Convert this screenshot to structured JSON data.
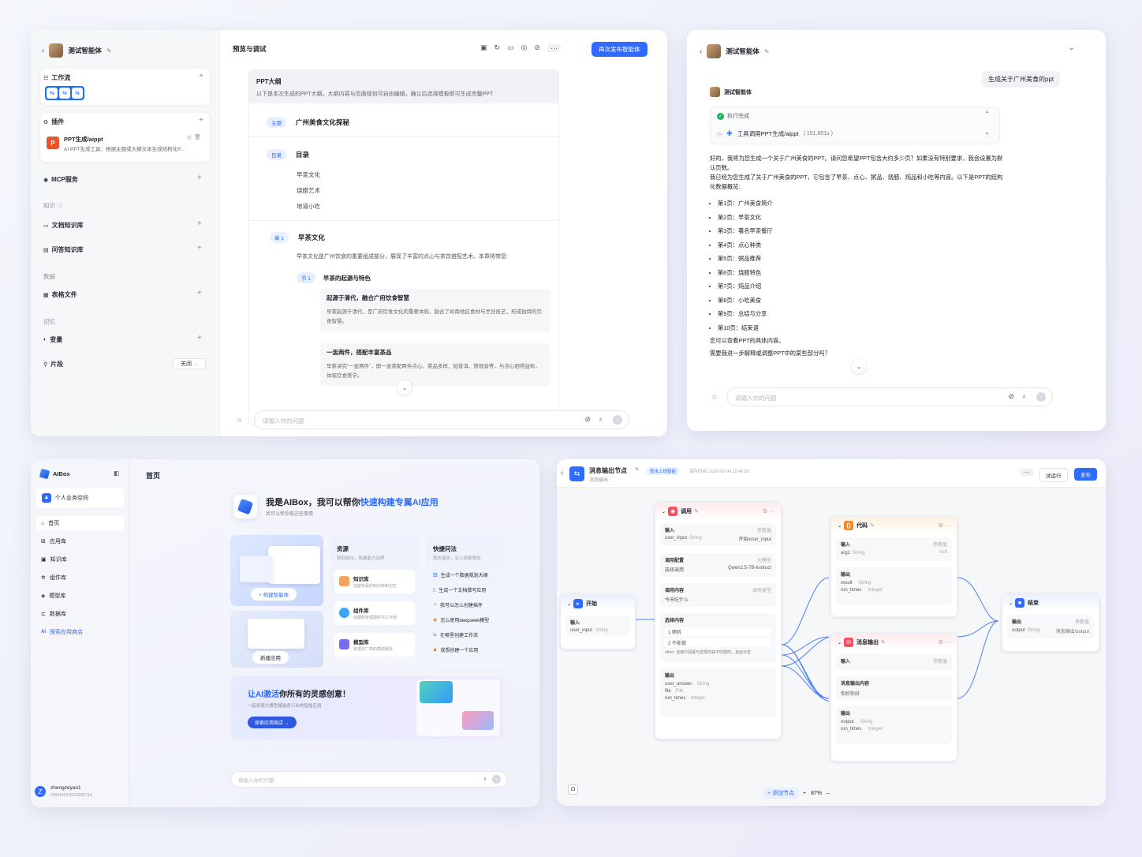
{
  "w1": {
    "agent_name": "测试智能体",
    "workflow_label": "工作流",
    "plugin_label": "插件",
    "plugin_name": "PPT生成/aippt",
    "plugin_desc": "AI PPT生成工具：根据主题或大纲文本生成结构化P...",
    "mcp_label": "MCP服务",
    "knowledge_label": "知识",
    "doc_kb": "文档知识库",
    "qa_kb": "问答知识库",
    "data_label": "数据",
    "table_file": "表格文件",
    "memory_label": "记忆",
    "variable": "变量",
    "snippet": "片段",
    "snippet_state": "关闭",
    "preview_title": "预览与调试",
    "publish_btn": "再次发布智能体",
    "outline_title": "PPT大纲",
    "outline_desc": "以下是本次生成的PPT大纲。大纲内容与页面规划可自由编辑，确认后选择模板即可生成完整PPT",
    "theme_tag": "主题",
    "theme": "广州美食文化探秘",
    "toc_tag": "目录",
    "toc_title": "目录",
    "toc_items": [
      "早茶文化",
      "烧腊艺术",
      "地道小吃"
    ],
    "ch_tag": "章 1",
    "ch_title": "早茶文化",
    "ch_desc": "早茶文化是广州饮食的重要组成部分，展现了丰富的点心与茶饮搭配艺术。本章将带您:",
    "sec_tag": "节 1",
    "sec_title": "早茶的起源与特色",
    "p1_title": "起源于清代，融合广府饮食智慧",
    "p1_text": "早茶起源于清代，是广府饮食文化的重要体现，融合了岭南地区食材与烹饪技艺，形成独特的饮食智慧。",
    "p2_title": "一盅两件，搭配丰富茶品",
    "p2_text": "早茶讲究“一盅两件”，即一盅茶配两件点心，茶品多样，如普洱、铁观音等，与点心相得益彰，体现饮食美学。",
    "input_ph": "请输入你的问题"
  },
  "w2": {
    "agent_name": "测试智能体",
    "user_msg": "生成关于广州美食的ppt",
    "bot_name": "测试智能体",
    "exec_done": "执行完成",
    "tool_call": "工具调用PPT生成/aippt",
    "tool_time": "( 151.851s )",
    "p1": "好的，我将为您生成一个关于广州美食的PPT。请问您希望PPT包含大约多少页？如果没有特别要求，我会设置为默认页数。",
    "p2": "我已经为您生成了关于广州美食的PPT，它包含了早茶、点心、粥品、烧腊、炖品和小吃等内容。以下是PPT的结构化数据概览:",
    "items": [
      "第1页：广州美食简介",
      "第2页：早茶文化",
      "第3页：著名早茶餐厅",
      "第4页：点心种类",
      "第5页：粥品推荐",
      "第6页：烧腊特色",
      "第7页：炖品介绍",
      "第8页：小吃美食",
      "第9页：总结与分享",
      "第10页：结束语"
    ],
    "p3": "您可以查看PPT的具体内容。",
    "p4": "需要我进一步解释或调整PPT中的某些部分吗？",
    "input_ph": "请输入你的问题"
  },
  "w3": {
    "brand": "AIBox",
    "workspace": "个人业务空间",
    "nav": [
      "首页",
      "应用库",
      "知识库",
      "组件库",
      "模型库",
      "数据库"
    ],
    "explore": "探索应用商店",
    "user_name": "zhengzeyan1",
    "user_id": "2004154378116595714",
    "page_title": "首页",
    "hero_pre": "我是AIBox，我可以帮你",
    "hero_hl": "快速构建专属AI应用",
    "hero_sub": "我可以帮你做这些事情",
    "build_btn": "+ 构建智能体",
    "new_app_btn": "新建应用",
    "res_title": "资源",
    "res_sub": "即刻前往，拓展能力边界",
    "res_items": [
      {
        "t": "知识库",
        "d": "创建专属的知识库和记忆"
      },
      {
        "t": "组件库",
        "d": "创建和管理插件与工作流"
      },
      {
        "t": "模型库",
        "d": "管理多厂商的模型服务"
      }
    ],
    "quick_title": "快捷问法",
    "quick_sub": "我也能答，深入探索体验",
    "quick_items": [
      "生成一个数据规划大纲",
      "生成一个文档撰写应用",
      "我可以怎么创建插件",
      "怎么使用deepseek模型",
      "在哪里创建工作流",
      "我想创建一个应用"
    ],
    "banner_pre": "让AI",
    "banner_hl": "激活",
    "banner_post": "你所有的灵感创意！",
    "banner_sub": "一起探索大模型赋能各行业的智能应用",
    "banner_btn": "探索应用商店 →",
    "input_ph": "请输入你的问题"
  },
  "w4": {
    "title": "消息输出节点",
    "subtitle": "消息输出",
    "badge": "暂未上线智能",
    "save_time": "保存时间: 2026-02-04 15:46:50",
    "trial_btn": "试运行",
    "publish_btn": "发布",
    "start": {
      "name": "开始",
      "in_label": "输入",
      "var": "user_input",
      "type": "String"
    },
    "llm": {
      "name": "调用",
      "in_label": "输入",
      "param": "参数值",
      "var": "user_input",
      "type": "String",
      "val": "开始/user_input",
      "cfg_label": "调用配置",
      "cfg_hint": "大模型",
      "model_label": "选择调用",
      "model": "Qwen2.5-7B-Instruct",
      "content_label": "调用内容",
      "content_hint": "调用类型",
      "content": "今天吃什么",
      "opt_label": "选择内容",
      "opts": [
        "1 随机",
        "2 不能做"
      ],
      "other": "other: 当用户回答与选项内容不匹配时，走此分支",
      "out_label": "输出",
      "outs": [
        {
          "n": "user_answer",
          "t": "String"
        },
        {
          "n": "file",
          "t": "File"
        },
        {
          "n": "run_times",
          "t": "Integer"
        }
      ]
    },
    "code": {
      "name": "代码",
      "in_label": "输入",
      "param": "参数值",
      "var": "arg1",
      "type": "String",
      "val": "rich",
      "out_label": "输出",
      "outs": [
        {
          "n": "result",
          "t": "String"
        },
        {
          "n": "run_times",
          "t": "Integer"
        }
      ]
    },
    "msg": {
      "name": "消息输出",
      "in_label": "输入",
      "param": "参数值",
      "content_label": "消息输出内容",
      "content": "你好你好",
      "out_label": "输出",
      "outs": [
        {
          "n": "output",
          "t": "String"
        },
        {
          "n": "run_times",
          "t": "Integer"
        }
      ]
    },
    "end": {
      "name": "结束",
      "out_label": "输出",
      "param": "参数值",
      "var": "output",
      "type": "String",
      "val": "消息输出/output"
    },
    "add_node": "+ 添加节点",
    "zoom": "87%"
  },
  "colors": {
    "accent": "#2f6bff",
    "start": "#2f6bff",
    "llm": "#f04f5f",
    "code": "#f08a24",
    "msg": "#f04f5f",
    "end": "#2f6bff"
  }
}
